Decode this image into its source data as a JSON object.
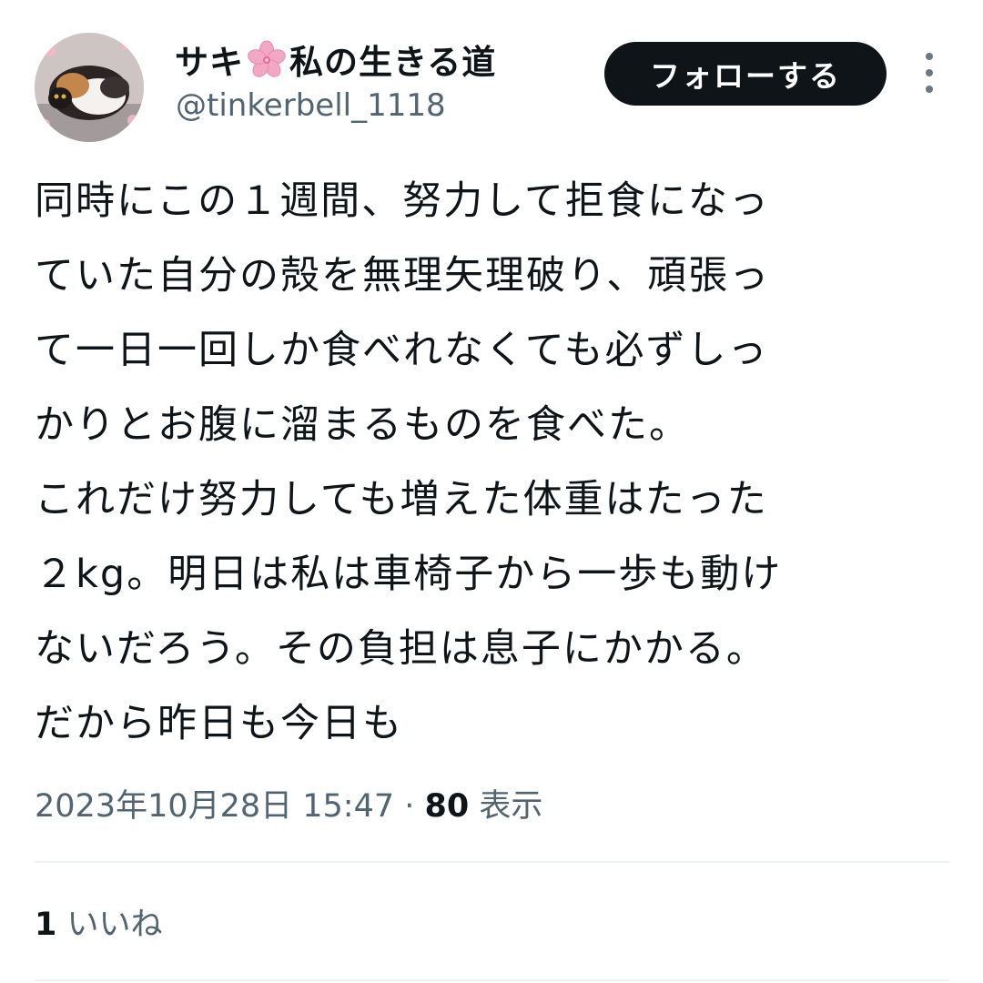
{
  "user": {
    "display_name_before": "サキ",
    "display_name_emoji": "cherry-blossom-icon",
    "display_name_after": "私の生きる道",
    "handle": "@tinkerbell_1118"
  },
  "follow_button": {
    "label": "フォローする"
  },
  "more_button": {
    "icon": "more-vertical-icon"
  },
  "tweet": {
    "lines": [
      "同時にこの１週間、努力して拒食になっ",
      "ていた自分の殻を無理矢理破り、頑張っ",
      "て一日一回しか食べれなくても必ずしっ",
      "かりとお腹に溜まるものを食べた。",
      "これだけ努力しても増えた体重はたった",
      "２kg。明日は私は車椅子から一歩も動け",
      "ないだろう。その負担は息子にかかる。",
      "だから昨日も今日も"
    ],
    "timestamp": "2023年10月28日 15:47",
    "separator": " · ",
    "views_count": "80",
    "views_label": " 表示"
  },
  "engagement": {
    "likes_count": "1",
    "likes_label": " いいね"
  },
  "colors": {
    "text_primary": "#0f1419",
    "text_secondary": "#536471",
    "button_bg": "#0f1419",
    "button_text": "#ffffff",
    "divider": "#eff3f4",
    "flower": "#f2a7c3"
  }
}
